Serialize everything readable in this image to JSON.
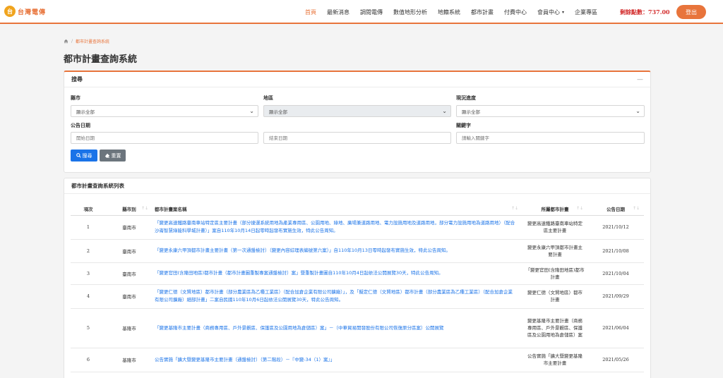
{
  "header": {
    "logo_mark": "台",
    "logo_text": "台灣電傳",
    "nav": [
      {
        "label": "首頁",
        "active": true
      },
      {
        "label": "最新消息"
      },
      {
        "label": "調閱電傳"
      },
      {
        "label": "數值地形分析"
      },
      {
        "label": "地籍系統"
      },
      {
        "label": "都市計畫"
      },
      {
        "label": "付費中心"
      },
      {
        "label": "會員中心",
        "dropdown": true
      },
      {
        "label": "企業專區"
      }
    ],
    "points": "剩餘點數：737.00",
    "logout": "登出"
  },
  "breadcrumb": {
    "current": "都市計畫查詢系統"
  },
  "page_title": "都市計畫查詢系統",
  "search": {
    "title": "搜尋",
    "collapse": "—",
    "county_label": "縣市",
    "county_value": "顯示全部",
    "district_label": "地區",
    "district_value": "顯示全部",
    "progress_label": "現況進度",
    "progress_value": "顯示全部",
    "date_label": "公告日期",
    "start_placeholder": "開始日期",
    "end_placeholder": "結束日期",
    "keyword_label": "關鍵字",
    "keyword_placeholder": "請輸入關鍵字",
    "search_button": "搜尋",
    "reset_button": "重置"
  },
  "results": {
    "title": "都市計畫查詢系統列表",
    "columns": [
      "項次",
      "縣市別",
      "都市計畫案名稱",
      "所屬都市計畫",
      "公告日期"
    ],
    "rows": [
      {
        "no": "1",
        "county": "臺南市",
        "name": "「變更高速鐵路臺南車站特定區主要計畫（部分捷運系統用地為產業專用區、公園用地、綠地、廣場兼道路用地、電力設施用地及道路用地，部分電力設施用地為道路用地）（配合沙崙智慧綠能科學城計畫）」案自110年10月14日起零時起發布實施生效，特此公告周知。",
        "plan": "變更高速鐵路臺南車站特定區主要計畫",
        "date": "2021/10/12"
      },
      {
        "no": "2",
        "county": "臺南市",
        "name": "「變更永康六甲頂都市計畫主要計畫（第一次通盤檢討）（變更內容綜理表編號第六案）」自110年10月13日零時起發布實施生效，特此公告周知。",
        "plan": "變更永康六甲頂都市計畫主要計畫",
        "date": "2021/10/08"
      },
      {
        "no": "3",
        "county": "臺南市",
        "name": "「變更官田(含隆田地區)都市計畫（都市計畫圖重製專案通盤檢討）案」暨重製計畫圖自110年10月4日起依法公開展覽30天，特此公告周知。",
        "plan": "「變更官田(含隆田地區)都市計畫",
        "date": "2021/10/04"
      },
      {
        "no": "4",
        "county": "臺南市",
        "name": "「變更仁德（文賢地區）都市計畫（部分農業區為乙種工業區）（配合加倉企業有限公司擴廠）」，及「擬定仁德（文賢地區）都市計畫（部分農業區為乙種工業區）（配合加倉企業有限公司擴廠）細部計畫」二案自民國110年10月6日起依法公開展覽30天，特此公告周知。",
        "plan": "變更仁德（文賢地區）都市計畫",
        "date": "2021/09/29"
      },
      {
        "no": "5",
        "county": "基隆市",
        "name": "「變更基隆市主要計畫（商務專用區、戶外景觀區、保護區及公園用地為倉儲區）案」－（中華貿易開發股份有限公司恢復原分區案）公開展覽",
        "plan": "變更基隆市主要計畫（商務專用區、戶外景觀區、保護區及公園用地為倉儲區）案",
        "date": "2021/06/04"
      },
      {
        "no": "6",
        "county": "基隆市",
        "name": "公告實施「擴大暨變更基隆市主要計畫（通盤檢討）（第二階段）－『中變-34（1）案』」",
        "plan": "公告實施「擴大暨變更基隆市主要計畫",
        "date": "2021/05/26"
      }
    ]
  }
}
